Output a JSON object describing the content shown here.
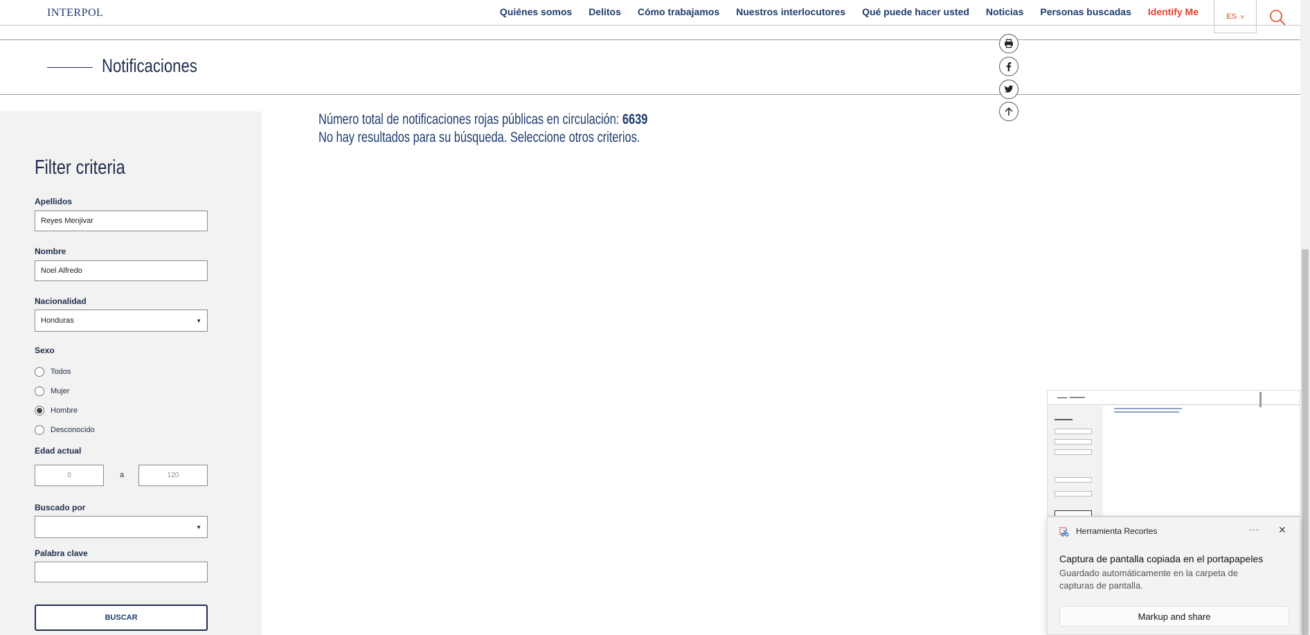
{
  "header": {
    "logo": "INTERPOL",
    "nav": [
      "Quiénes somos",
      "Delitos",
      "Cómo trabajamos",
      "Nuestros interlocutores",
      "Qué puede hacer usted",
      "Noticias",
      "Personas buscadas"
    ],
    "identify": "Identify Me",
    "lang": "ES",
    "lang_caret": "v"
  },
  "page": {
    "title": "Notificaciones"
  },
  "results": {
    "total_label": "Número total de notificaciones rojas públicas en circulación:",
    "total": "6639",
    "no_results": "No hay resultados para su búsqueda. Seleccione otros criterios."
  },
  "filter": {
    "title": "Filter criteria",
    "apellidos_label": "Apellidos",
    "apellidos_value": "Reyes Menjivar",
    "nombre_label": "Nombre",
    "nombre_value": "Noel Alfredo",
    "nacionalidad_label": "Nacionalidad",
    "nacionalidad_value": "Honduras",
    "sexo_label": "Sexo",
    "sexo_options": [
      "Todos",
      "Mujer",
      "Hombre",
      "Desconocido"
    ],
    "sexo_selected": "Hombre",
    "edad_label": "Edad actual",
    "edad_min": "0",
    "edad_sep": "a",
    "edad_max": "120",
    "buscado_label": "Buscado por",
    "buscado_value": "",
    "palabra_label": "Palabra clave",
    "palabra_value": "",
    "search_button": "BUSCAR"
  },
  "toast": {
    "app": "Herramienta Recortes",
    "more": "···",
    "close": "✕",
    "title": "Captura de pantalla copiada en el portapapeles",
    "body": "Guardado automáticamente en la carpeta de capturas de pantalla.",
    "button": "Markup and share"
  },
  "colors": {
    "navy": "#1d3b6e",
    "accent_red": "#e5412b",
    "sidebar_bg": "#f2f2f2"
  }
}
